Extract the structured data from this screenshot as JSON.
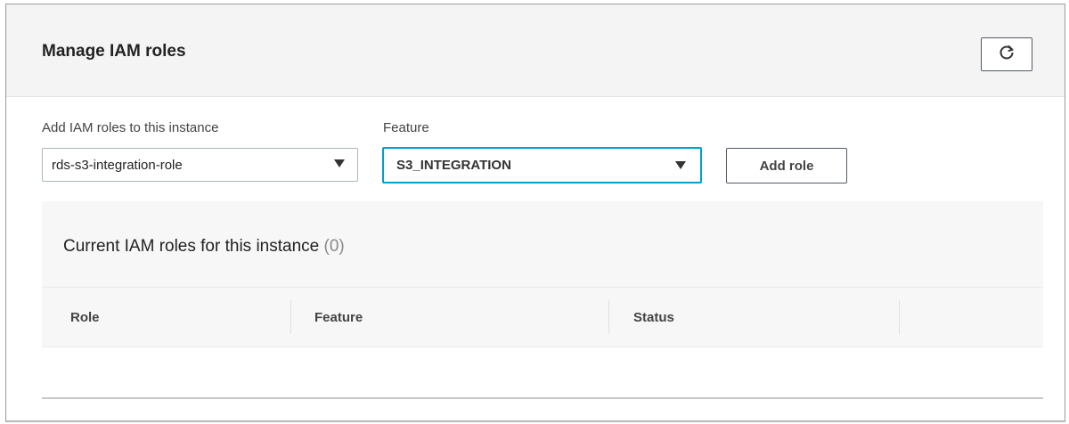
{
  "panel": {
    "title": "Manage IAM roles",
    "refresh_icon": "refresh-icon"
  },
  "form": {
    "role_label": "Add IAM roles to this instance",
    "role_value": "rds-s3-integration-role",
    "feature_label": "Feature",
    "feature_value": "S3_INTEGRATION",
    "add_button": "Add role"
  },
  "table": {
    "title": "Current IAM roles for this instance",
    "count": "(0)",
    "columns": [
      "Role",
      "Feature",
      "Status"
    ]
  },
  "colors": {
    "focus_border": "#00a1c9",
    "header_bg": "#f4f4f4",
    "button_border": "#545b64"
  }
}
